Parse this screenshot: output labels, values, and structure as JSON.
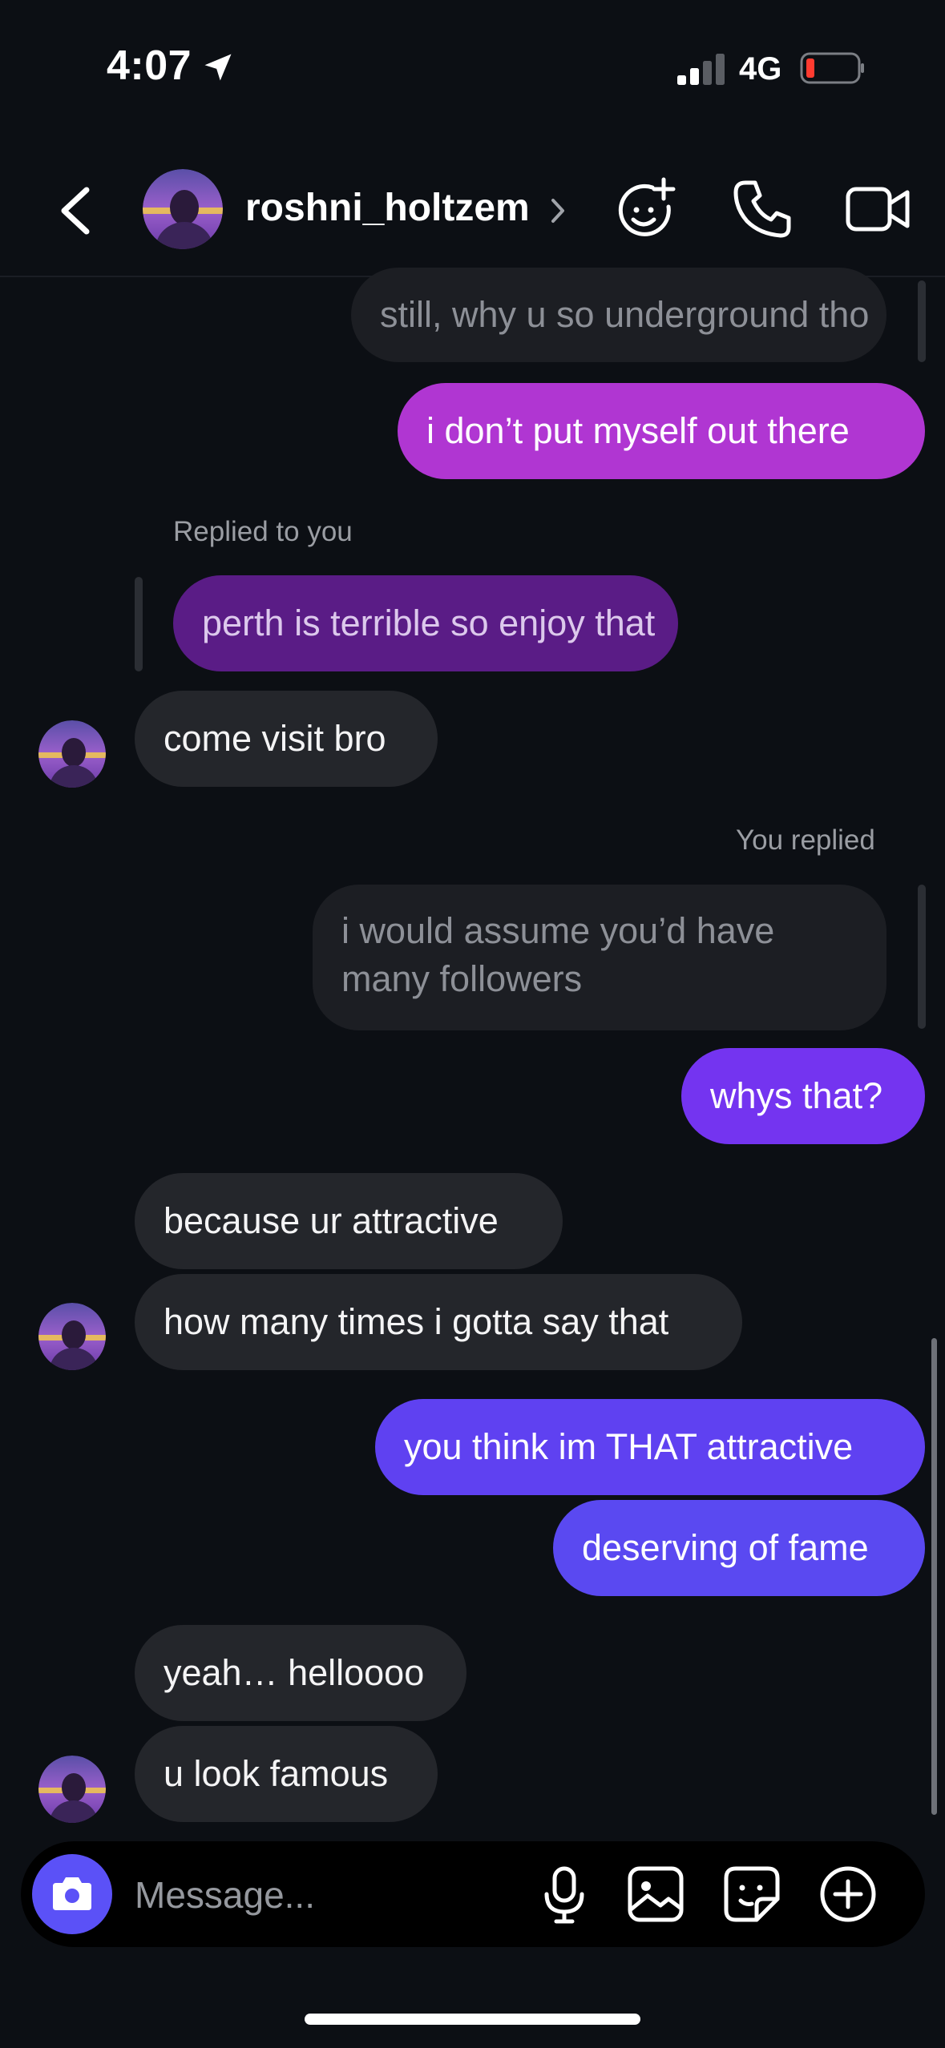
{
  "status_bar": {
    "time": "4:07",
    "network": "4G"
  },
  "header": {
    "contact_name": "roshni_holtzem"
  },
  "messages": {
    "m1": "still, why u so underground tho",
    "m2": "i don’t put myself out there",
    "m3_label": "Replied to you",
    "m3_quote": "perth is terrible so enjoy that",
    "m4": "come visit bro",
    "m5_label": "You replied",
    "m5_quote": "i would assume you’d have many followers",
    "m6": "whys that?",
    "m7": "because ur attractive",
    "m8": "how many times i gotta say that",
    "m9": "you think im THAT attractive",
    "m10": "deserving of fame",
    "m11": "yeah… hellोooo",
    "m12": "u look famous"
  },
  "composer": {
    "placeholder": "Message..."
  },
  "colors": {
    "background": "#0c0f14",
    "incoming_bubble": "#24262b",
    "outgoing_magenta": "#b036d2",
    "outgoing_violet": "#7434f0",
    "outgoing_indigo": "#5a49f1",
    "camera_button": "#5b51f7"
  },
  "icons": [
    "location-arrow-icon",
    "signal-icon",
    "battery-icon",
    "back-icon",
    "chevron-right-icon",
    "effects-icon",
    "phone-icon",
    "video-icon",
    "camera-icon",
    "mic-icon",
    "gallery-icon",
    "sticker-icon",
    "plus-icon"
  ]
}
